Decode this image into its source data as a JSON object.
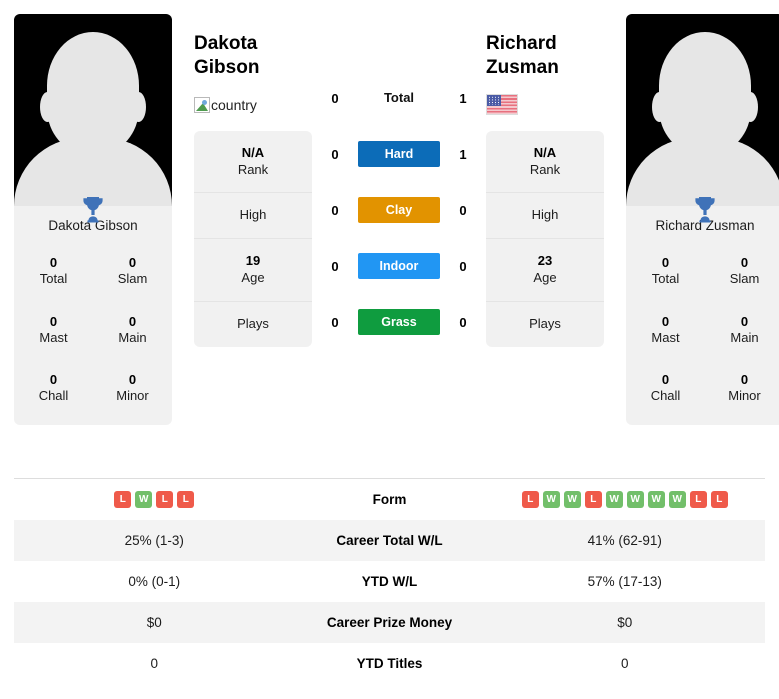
{
  "players": {
    "left": {
      "name": "Dakota Gibson",
      "name_line1": "Dakota",
      "name_line2": "Gibson",
      "flag_alt": "country",
      "flag_type": "broken-image",
      "rank_value": "N/A",
      "rank_label": "Rank",
      "high_value": "",
      "high_label": "High",
      "age_value": "19",
      "age_label": "Age",
      "plays_value": "",
      "plays_label": "Plays",
      "titles": [
        {
          "value": "0",
          "label": "Total"
        },
        {
          "value": "0",
          "label": "Slam"
        },
        {
          "value": "0",
          "label": "Mast"
        },
        {
          "value": "0",
          "label": "Main"
        },
        {
          "value": "0",
          "label": "Chall"
        },
        {
          "value": "0",
          "label": "Minor"
        }
      ],
      "form": [
        "L",
        "W",
        "L",
        "L"
      ],
      "career_wl": "25% (1-3)",
      "ytd_wl": "0% (0-1)",
      "prize_money": "$0",
      "ytd_titles": "0"
    },
    "right": {
      "name": "Richard Zusman",
      "name_line1": "Richard",
      "name_line2": "Zusman",
      "flag_alt": "United States",
      "flag_type": "us-flag",
      "rank_value": "N/A",
      "rank_label": "Rank",
      "high_value": "",
      "high_label": "High",
      "age_value": "23",
      "age_label": "Age",
      "plays_value": "",
      "plays_label": "Plays",
      "titles": [
        {
          "value": "0",
          "label": "Total"
        },
        {
          "value": "0",
          "label": "Slam"
        },
        {
          "value": "0",
          "label": "Mast"
        },
        {
          "value": "0",
          "label": "Main"
        },
        {
          "value": "0",
          "label": "Chall"
        },
        {
          "value": "0",
          "label": "Minor"
        }
      ],
      "form": [
        "L",
        "W",
        "W",
        "L",
        "W",
        "W",
        "W",
        "W",
        "L",
        "L"
      ],
      "career_wl": "41% (62-91)",
      "ytd_wl": "57% (17-13)",
      "prize_money": "$0",
      "ytd_titles": "0"
    }
  },
  "head_to_head": [
    {
      "label": "Total",
      "left": "0",
      "right": "1",
      "style": "plain",
      "color": ""
    },
    {
      "label": "Hard",
      "left": "0",
      "right": "1",
      "style": "bar",
      "color": "#0c6cb8"
    },
    {
      "label": "Clay",
      "left": "0",
      "right": "0",
      "style": "bar",
      "color": "#e29300"
    },
    {
      "label": "Indoor",
      "left": "0",
      "right": "0",
      "style": "bar",
      "color": "#2196f3"
    },
    {
      "label": "Grass",
      "left": "0",
      "right": "0",
      "style": "bar",
      "color": "#0f9c3f"
    }
  ],
  "stats_table": [
    {
      "label": "Form",
      "type": "form",
      "alt": false
    },
    {
      "label": "Career Total W/L",
      "type": "text",
      "key": "career_wl",
      "alt": true
    },
    {
      "label": "YTD W/L",
      "type": "text",
      "key": "ytd_wl",
      "alt": false
    },
    {
      "label": "Career Prize Money",
      "type": "text",
      "key": "prize_money",
      "alt": true
    },
    {
      "label": "YTD Titles",
      "type": "text",
      "key": "ytd_titles",
      "alt": false
    }
  ],
  "colors": {
    "win": "#72bf6a",
    "loss": "#ef5a4a",
    "trophy": "#3f72b8",
    "card_bg": "#f1f1f1",
    "row_alt": "#f3f3f3"
  },
  "icons": {
    "trophy": "trophy-icon"
  }
}
